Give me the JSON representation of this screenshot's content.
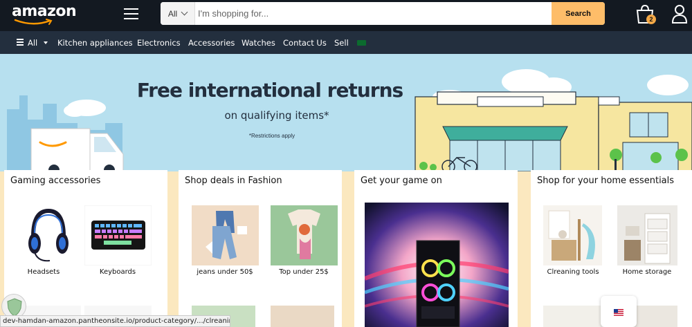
{
  "header": {
    "logo_text": "amazon",
    "search": {
      "category": "All",
      "placeholder": "I'm shopping for...",
      "button_label": "Search"
    },
    "cart_count": "2"
  },
  "nav": {
    "all_label": "All",
    "items": [
      "Kitchen appliances",
      "Electronics",
      "Accessories",
      "Watches",
      "Contact Us",
      "Sell"
    ]
  },
  "hero": {
    "title": "Free international returns",
    "subtitle": "on qualifying items*",
    "note": "*Restrictions apply"
  },
  "cards": [
    {
      "title": "Gaming accessories",
      "tiles": [
        {
          "label": "Headsets",
          "icon": "headset-image"
        },
        {
          "label": "Keyboards",
          "icon": "keyboard-image"
        }
      ]
    },
    {
      "title": "Shop deals in Fashion",
      "tiles": [
        {
          "label": "jeans under 50$",
          "icon": "jeans-image"
        },
        {
          "label": "Top under 25$",
          "icon": "top-image"
        }
      ]
    },
    {
      "title": "Get your game on",
      "tiles": []
    },
    {
      "title": "Shop for your home essentials",
      "tiles": [
        {
          "label": "Clreaning tools",
          "icon": "cleaning-tools-image"
        },
        {
          "label": "Home storage",
          "icon": "storage-image"
        }
      ]
    }
  ],
  "status_url": "dev-hamdan-amazon.pantheonsite.io/product-category/.../clreaning-tools/",
  "colors": {
    "header_bg": "#131921",
    "nav_bg": "#232f3e",
    "search_button": "#febd69",
    "hero_bg": "#b7e0ef",
    "cards_bg": "#fbe8bf"
  }
}
